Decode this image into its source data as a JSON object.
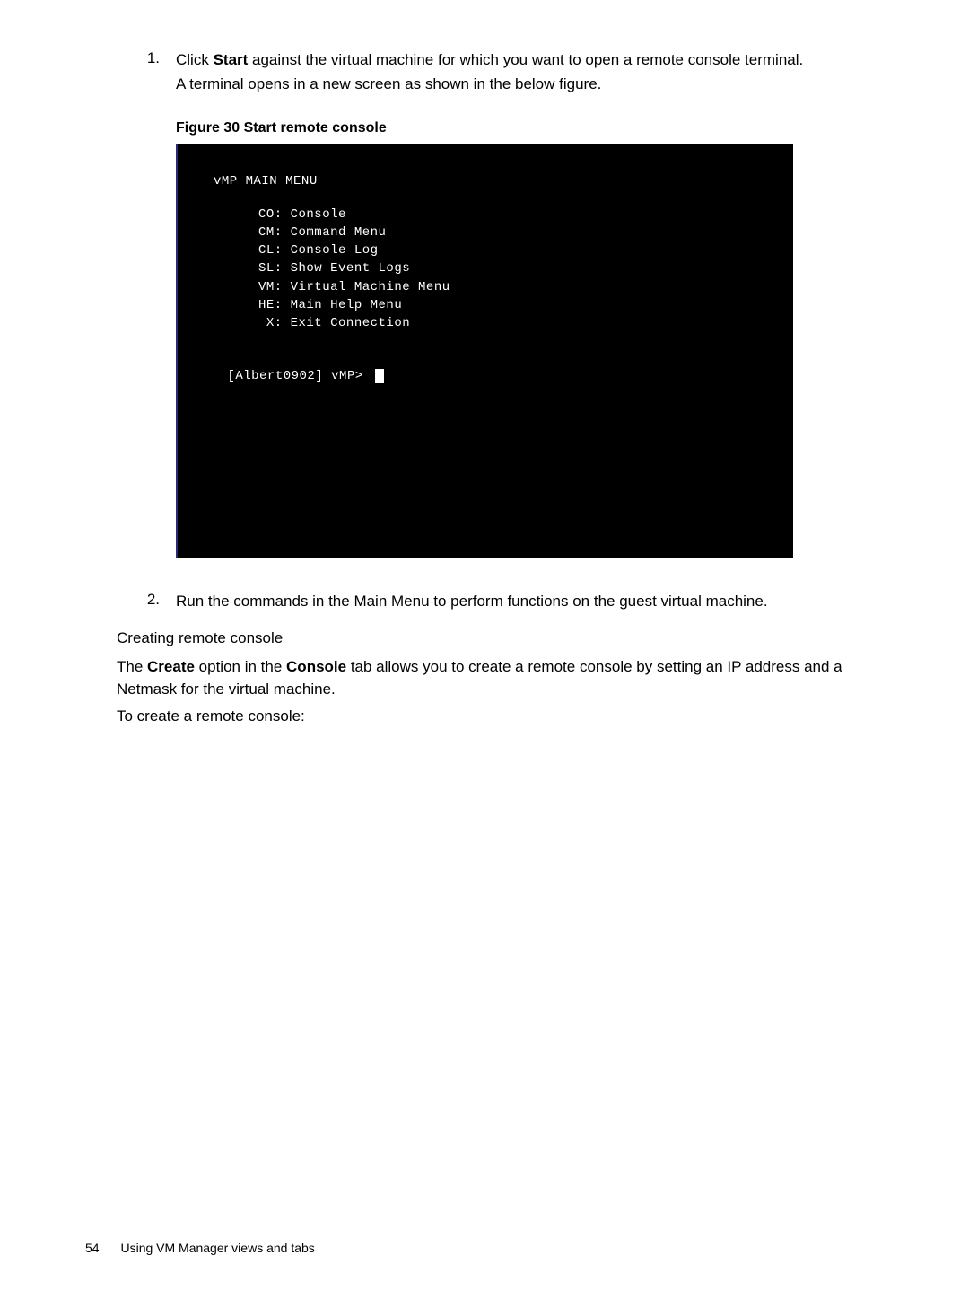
{
  "step1": {
    "num": "1.",
    "text_a": "Click ",
    "text_b": "Start",
    "text_c": " against the virtual machine for which you want to open a remote console terminal.",
    "line2": "A terminal opens in a new screen as shown in the below figure."
  },
  "figure_caption": "Figure 30 Start remote console",
  "terminal": {
    "title": "vMP MAIN MENU",
    "lines": [
      "CO: Console",
      "CM: Command Menu",
      "CL: Console Log",
      "SL: Show Event Logs",
      "VM: Virtual Machine Menu",
      "HE: Main Help Menu",
      " X: Exit Connection"
    ],
    "prompt": "[Albert0902] vMP> "
  },
  "step2": {
    "num": "2.",
    "text": "Run the commands in the Main Menu to perform functions on the guest virtual machine."
  },
  "sub_heading": "Creating remote console",
  "para1_a": "The ",
  "para1_b": "Create",
  "para1_c": " option in the ",
  "para1_d": "Console",
  "para1_e": " tab allows you to create a remote console by setting an IP address and a Netmask for the virtual machine.",
  "para2": "To create a remote console:",
  "footer": {
    "page": "54",
    "section": "Using VM Manager views and tabs"
  }
}
